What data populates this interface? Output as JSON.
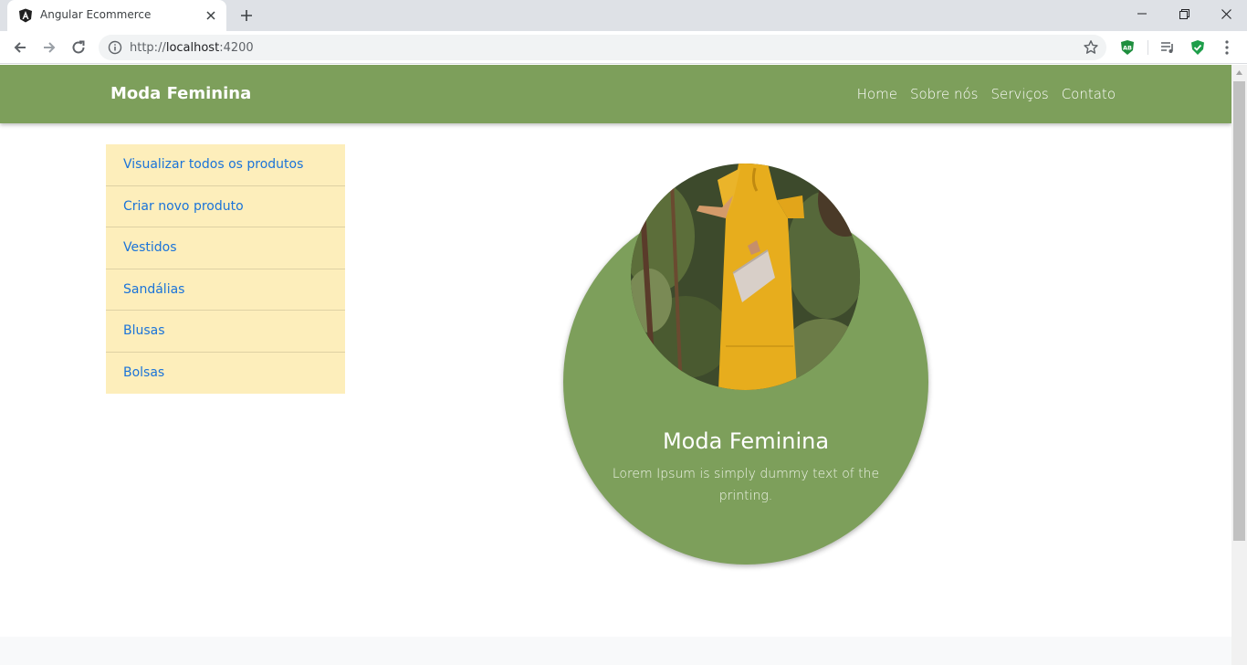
{
  "browser": {
    "tab_title": "Angular Ecommerce",
    "url_prefix": "http://",
    "url_host": "localhost",
    "url_port": ":4200",
    "extension_badge": "AB"
  },
  "navbar": {
    "brand": "Moda Feminina",
    "links": [
      "Home",
      "Sobre nós",
      "Serviços",
      "Contato"
    ]
  },
  "sidebar": {
    "items": [
      "Visualizar todos os produtos",
      "Criar novo produto",
      "Vestidos",
      "Sandálias",
      "Blusas",
      "Bolsas"
    ]
  },
  "hero": {
    "title": "Moda Feminina",
    "text": "Lorem Ipsum is simply dummy text of the printing."
  },
  "colors": {
    "navbar_green": "#7d9f5b",
    "sidebar_bg": "#fdeebb",
    "link_blue": "#1a73d9"
  }
}
